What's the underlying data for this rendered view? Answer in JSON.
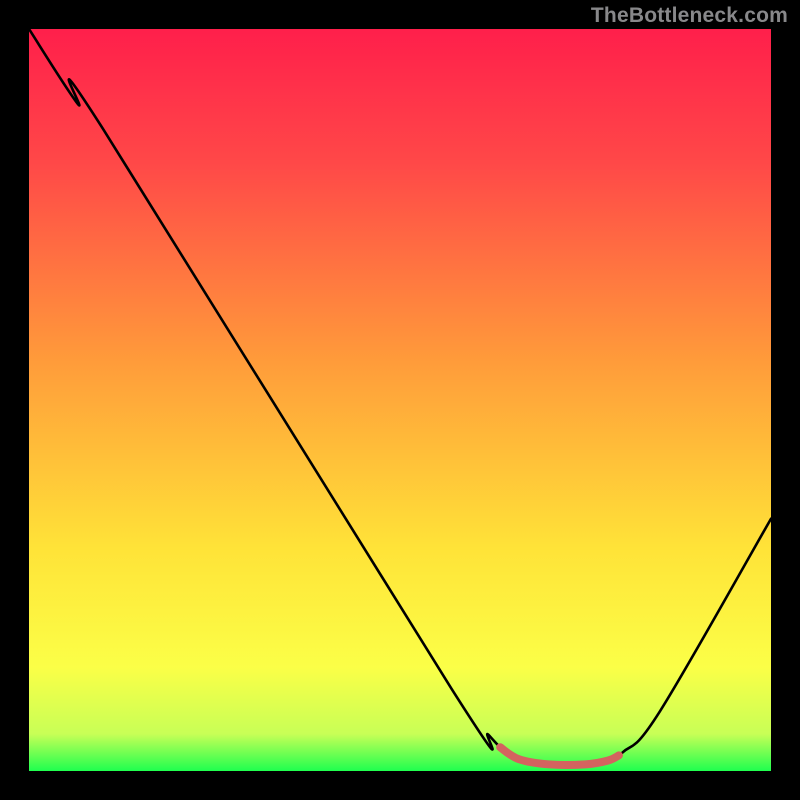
{
  "watermark": "TheBottleneck.com",
  "chart_data": {
    "type": "line",
    "title": "",
    "xlabel": "",
    "ylabel": "",
    "xlim": [
      0,
      100
    ],
    "ylim": [
      0,
      100
    ],
    "gradient_stops": [
      {
        "offset": 0,
        "color": "#ff1f4b"
      },
      {
        "offset": 18,
        "color": "#ff4848"
      },
      {
        "offset": 45,
        "color": "#ff9c3a"
      },
      {
        "offset": 70,
        "color": "#ffe338"
      },
      {
        "offset": 86,
        "color": "#fbff47"
      },
      {
        "offset": 95,
        "color": "#c8ff56"
      },
      {
        "offset": 100,
        "color": "#1fff4f"
      }
    ],
    "series": [
      {
        "name": "bottleneck-curve",
        "color": "#000000",
        "points": [
          {
            "x": 0.0,
            "y": 100.0
          },
          {
            "x": 6.5,
            "y": 90.0
          },
          {
            "x": 10.0,
            "y": 86.5
          },
          {
            "x": 57.0,
            "y": 11.0
          },
          {
            "x": 62.0,
            "y": 4.8
          },
          {
            "x": 65.0,
            "y": 2.0
          },
          {
            "x": 68.0,
            "y": 1.0
          },
          {
            "x": 75.0,
            "y": 0.8
          },
          {
            "x": 78.0,
            "y": 1.2
          },
          {
            "x": 80.0,
            "y": 2.5
          },
          {
            "x": 85.0,
            "y": 8.0
          },
          {
            "x": 100.0,
            "y": 34.0
          }
        ]
      },
      {
        "name": "highlight-segment",
        "color": "#d4635f",
        "points": [
          {
            "x": 63.5,
            "y": 3.2
          },
          {
            "x": 66.0,
            "y": 1.6
          },
          {
            "x": 70.0,
            "y": 0.9
          },
          {
            "x": 75.0,
            "y": 0.9
          },
          {
            "x": 78.0,
            "y": 1.4
          },
          {
            "x": 79.5,
            "y": 2.1
          }
        ]
      }
    ]
  }
}
